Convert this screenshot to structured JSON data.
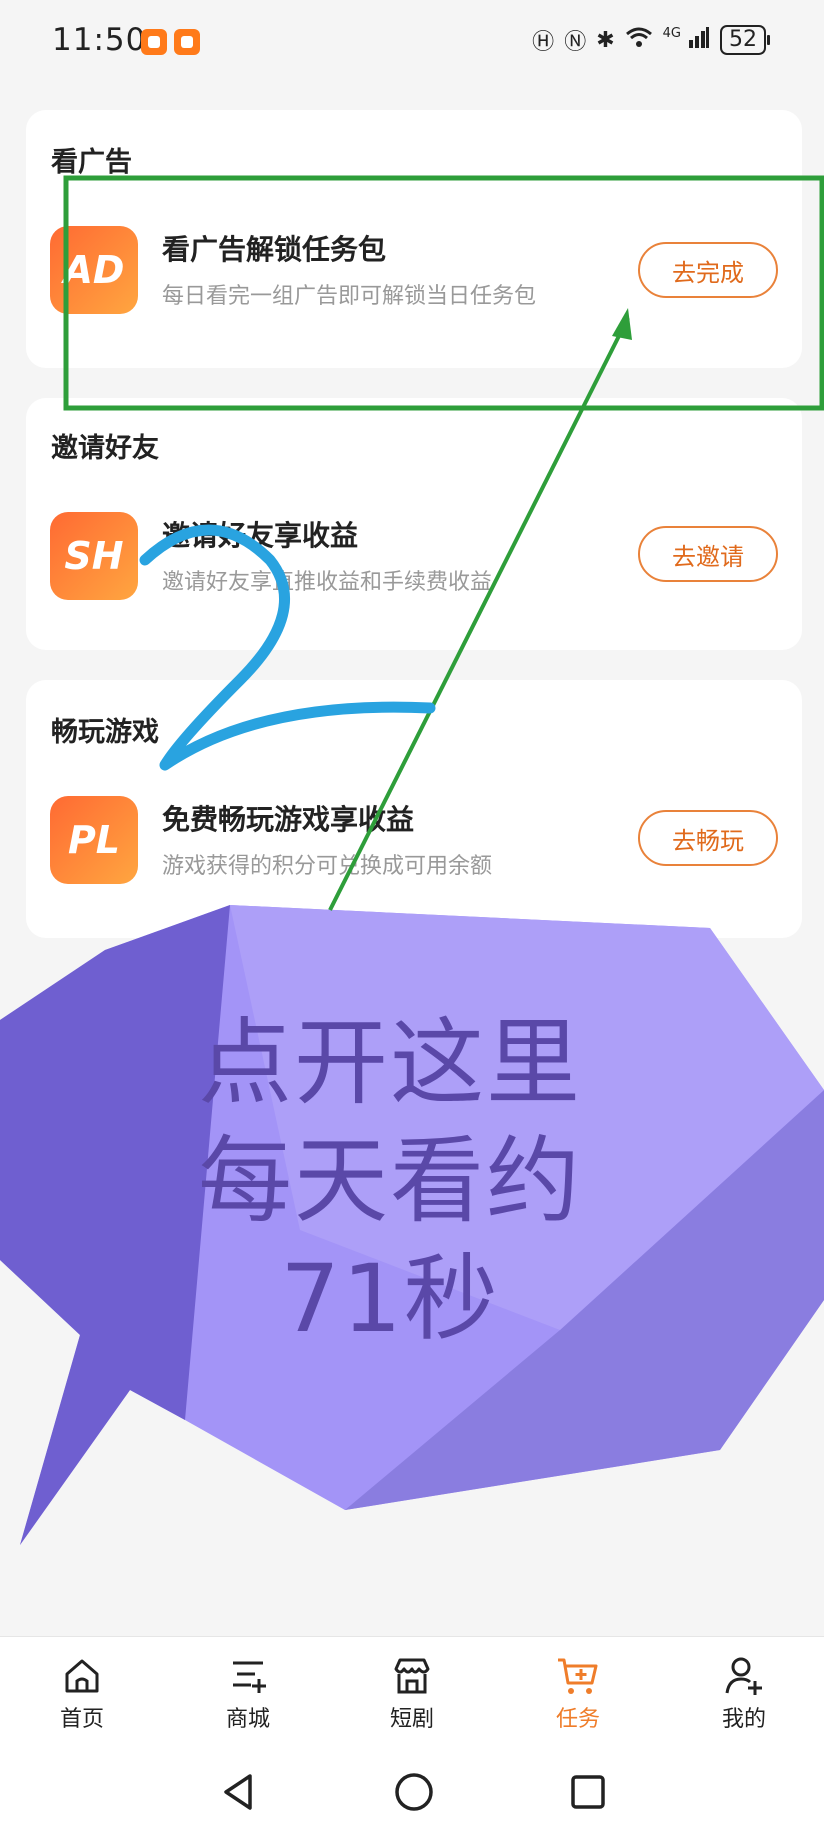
{
  "status_bar": {
    "time": "11:50",
    "network": "4G",
    "battery": "52"
  },
  "sections": [
    {
      "title": "看广告",
      "logo_text": "AD",
      "item_title": "看广告解锁任务包",
      "item_desc": "每日看完一组广告即可解锁当日任务包",
      "button": "去完成"
    },
    {
      "title": "邀请好友",
      "logo_text": "SH",
      "item_title": "邀请好友享收益",
      "item_desc": "邀请好友享直推收益和手续费收益",
      "button": "去邀请"
    },
    {
      "title": "畅玩游戏",
      "logo_text": "PL",
      "item_title": "免费畅玩游戏享收益",
      "item_desc": "游戏获得的积分可兑换成可用余额",
      "button": "去畅玩"
    }
  ],
  "annotation": {
    "lines": [
      "点开这里",
      "每天看约",
      "71秒"
    ],
    "bubble_color": "#9b8ef5",
    "box_color": "#2e9e3a",
    "arrow_color": "#2e9e3a",
    "scribble_color": "#29a3e0"
  },
  "bottom_nav": [
    {
      "label": "首页",
      "icon": "home-icon"
    },
    {
      "label": "商城",
      "icon": "list-add-icon"
    },
    {
      "label": "短剧",
      "icon": "store-icon"
    },
    {
      "label": "任务",
      "icon": "cart-add-icon",
      "active": true
    },
    {
      "label": "我的",
      "icon": "user-add-icon"
    }
  ],
  "colors": {
    "accent": "#ef7d2a",
    "background": "#f5f5f5"
  }
}
